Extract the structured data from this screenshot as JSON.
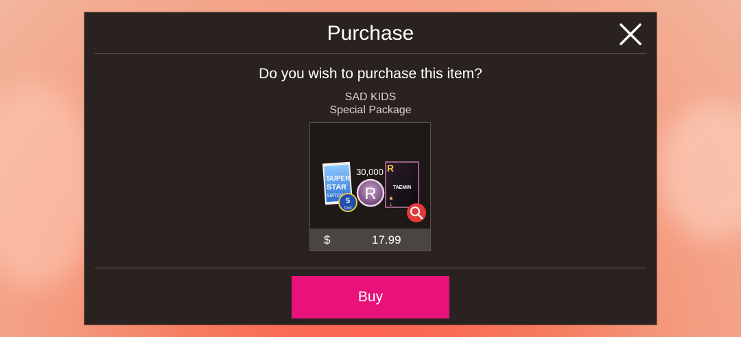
{
  "dialog": {
    "title": "Purchase",
    "question": "Do you wish to purchase this item?",
    "item": {
      "name_line1": "SAD KIDS",
      "name_line2": "Special Package",
      "currency": "$",
      "price": "17.99",
      "image_text": {
        "album_line1": "SUPER",
        "album_line2": "STAR",
        "album_line3": "SMTOWN",
        "card_count": "5",
        "card_word": "Card",
        "coin_amount": "30,000",
        "coin_letter": "R",
        "card_rank": "R",
        "card_artist": "TAEMIN",
        "card_star_count": "1"
      }
    },
    "buy_label": "Buy"
  },
  "colors": {
    "dialog_bg": "#2a2220",
    "buy_button": "#e8127a",
    "price_bar": "#4a4442",
    "zoom_button": "#e23a3a"
  }
}
